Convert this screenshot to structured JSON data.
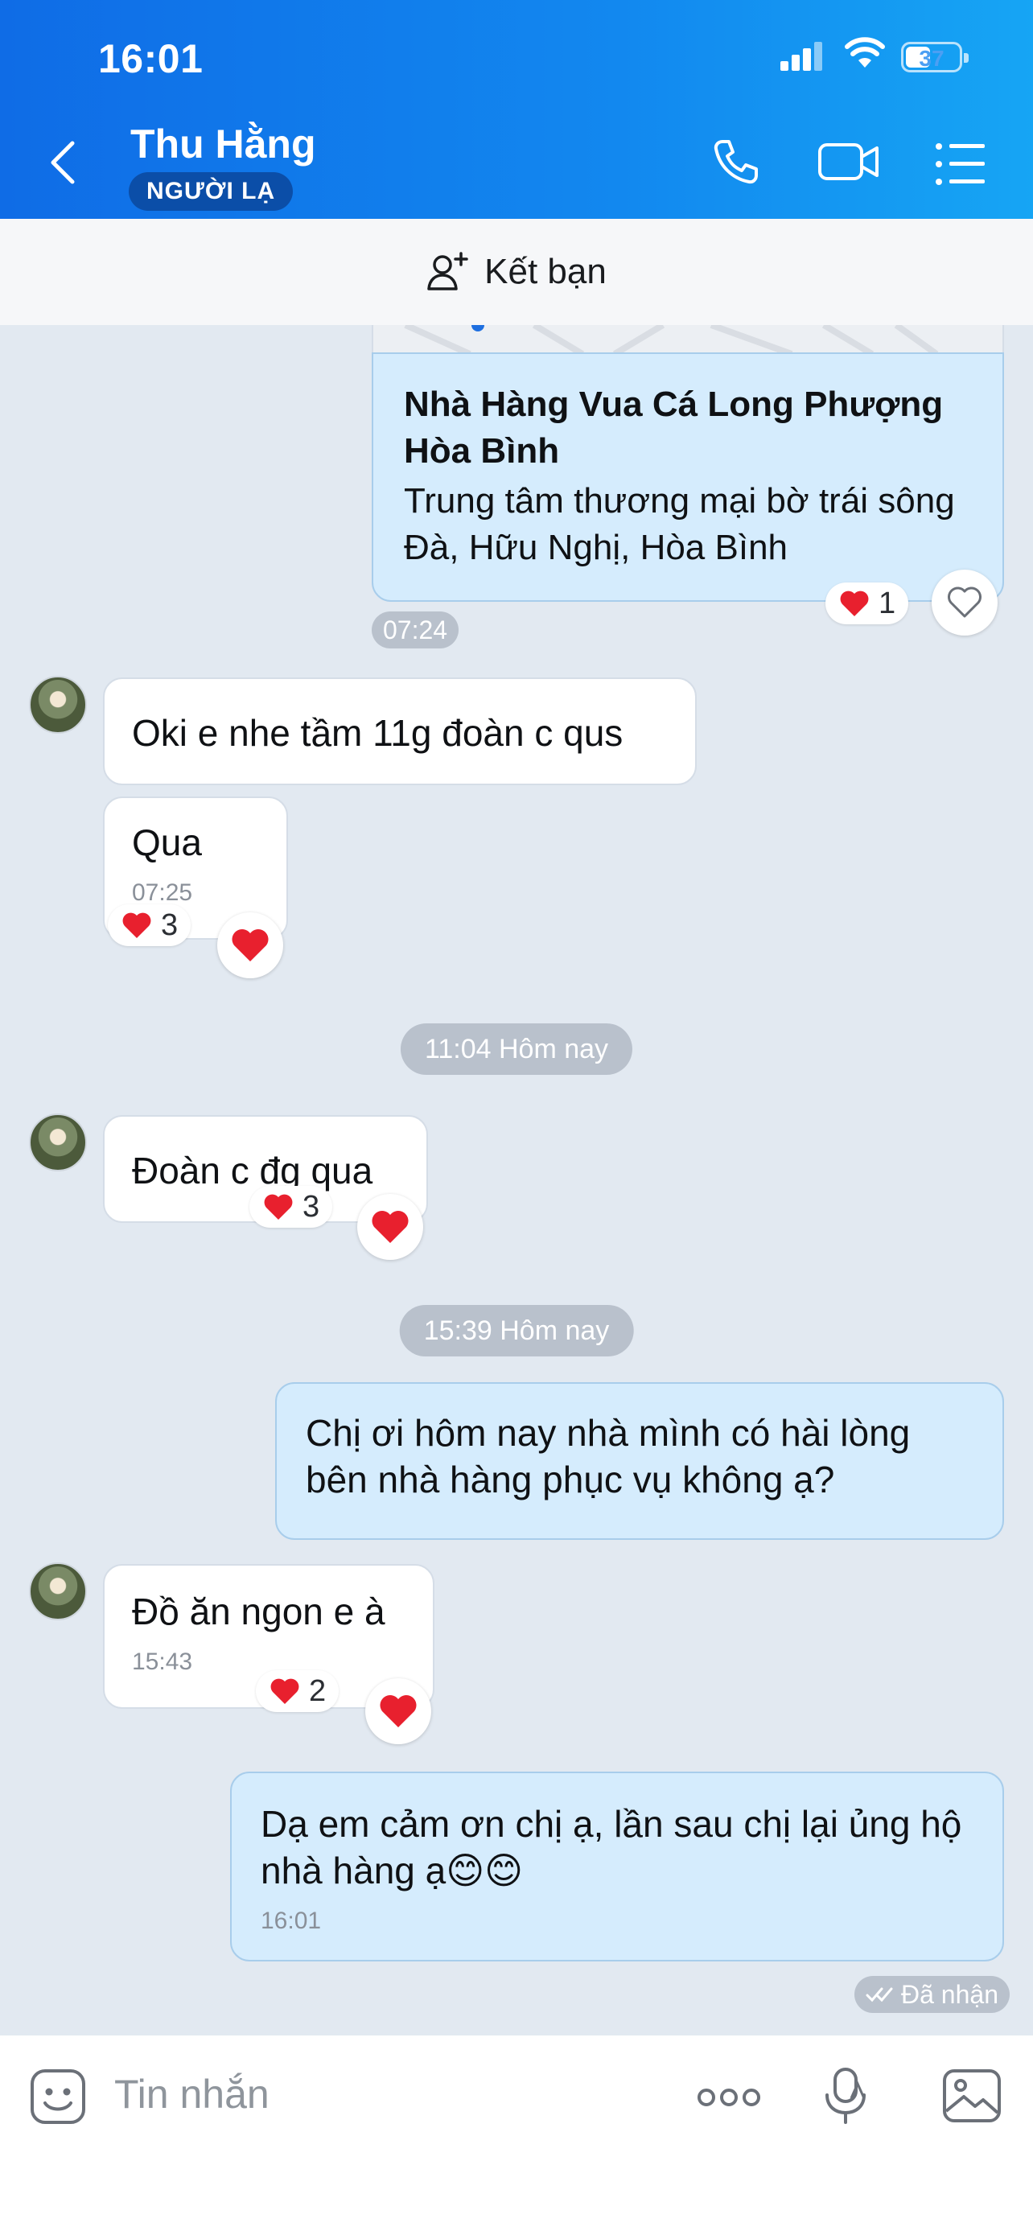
{
  "status_bar": {
    "time": "16:01",
    "battery": "37"
  },
  "header": {
    "contact_name": "Thu Hằng",
    "badge": "NGƯỜI LẠ"
  },
  "friend_bar": {
    "label": "Kết bạn"
  },
  "location_card": {
    "name": "Nhà Hàng Vua Cá Long Phượng Hòa Bình",
    "address": "Trung tâm thương mại bờ trái sông Đà, Hữu Nghị, Hòa Bình",
    "reaction_count": "1",
    "time": "07:24"
  },
  "messages": [
    {
      "text": "Oki e nhe tầm 11g đoàn c qus"
    },
    {
      "text": "Qua",
      "time": "07:25",
      "reaction_count": "3"
    },
    {
      "text": "Đoàn c đg qua",
      "reaction_count": "3"
    },
    {
      "text": "Chị ơi hôm nay nhà mình có hài lòng bên nhà hàng phục vụ không ạ?"
    },
    {
      "text": "Đồ ăn ngon e à",
      "time": "15:43",
      "reaction_count": "2"
    },
    {
      "text": "Dạ em cảm ơn chị ạ, lần sau chị lại ủng hộ nhà hàng ạ😊😊",
      "time": "16:01"
    }
  ],
  "dividers": [
    "11:04 Hôm nay",
    "15:39 Hôm nay"
  ],
  "delivery_status": "Đã nhận",
  "composer": {
    "placeholder": "Tin nhắn"
  },
  "colors": {
    "header_blue": "#0f6ce6",
    "my_bubble": "#d5ecfd",
    "chat_bg": "#e2e9f1",
    "heart": "#e8202e"
  }
}
